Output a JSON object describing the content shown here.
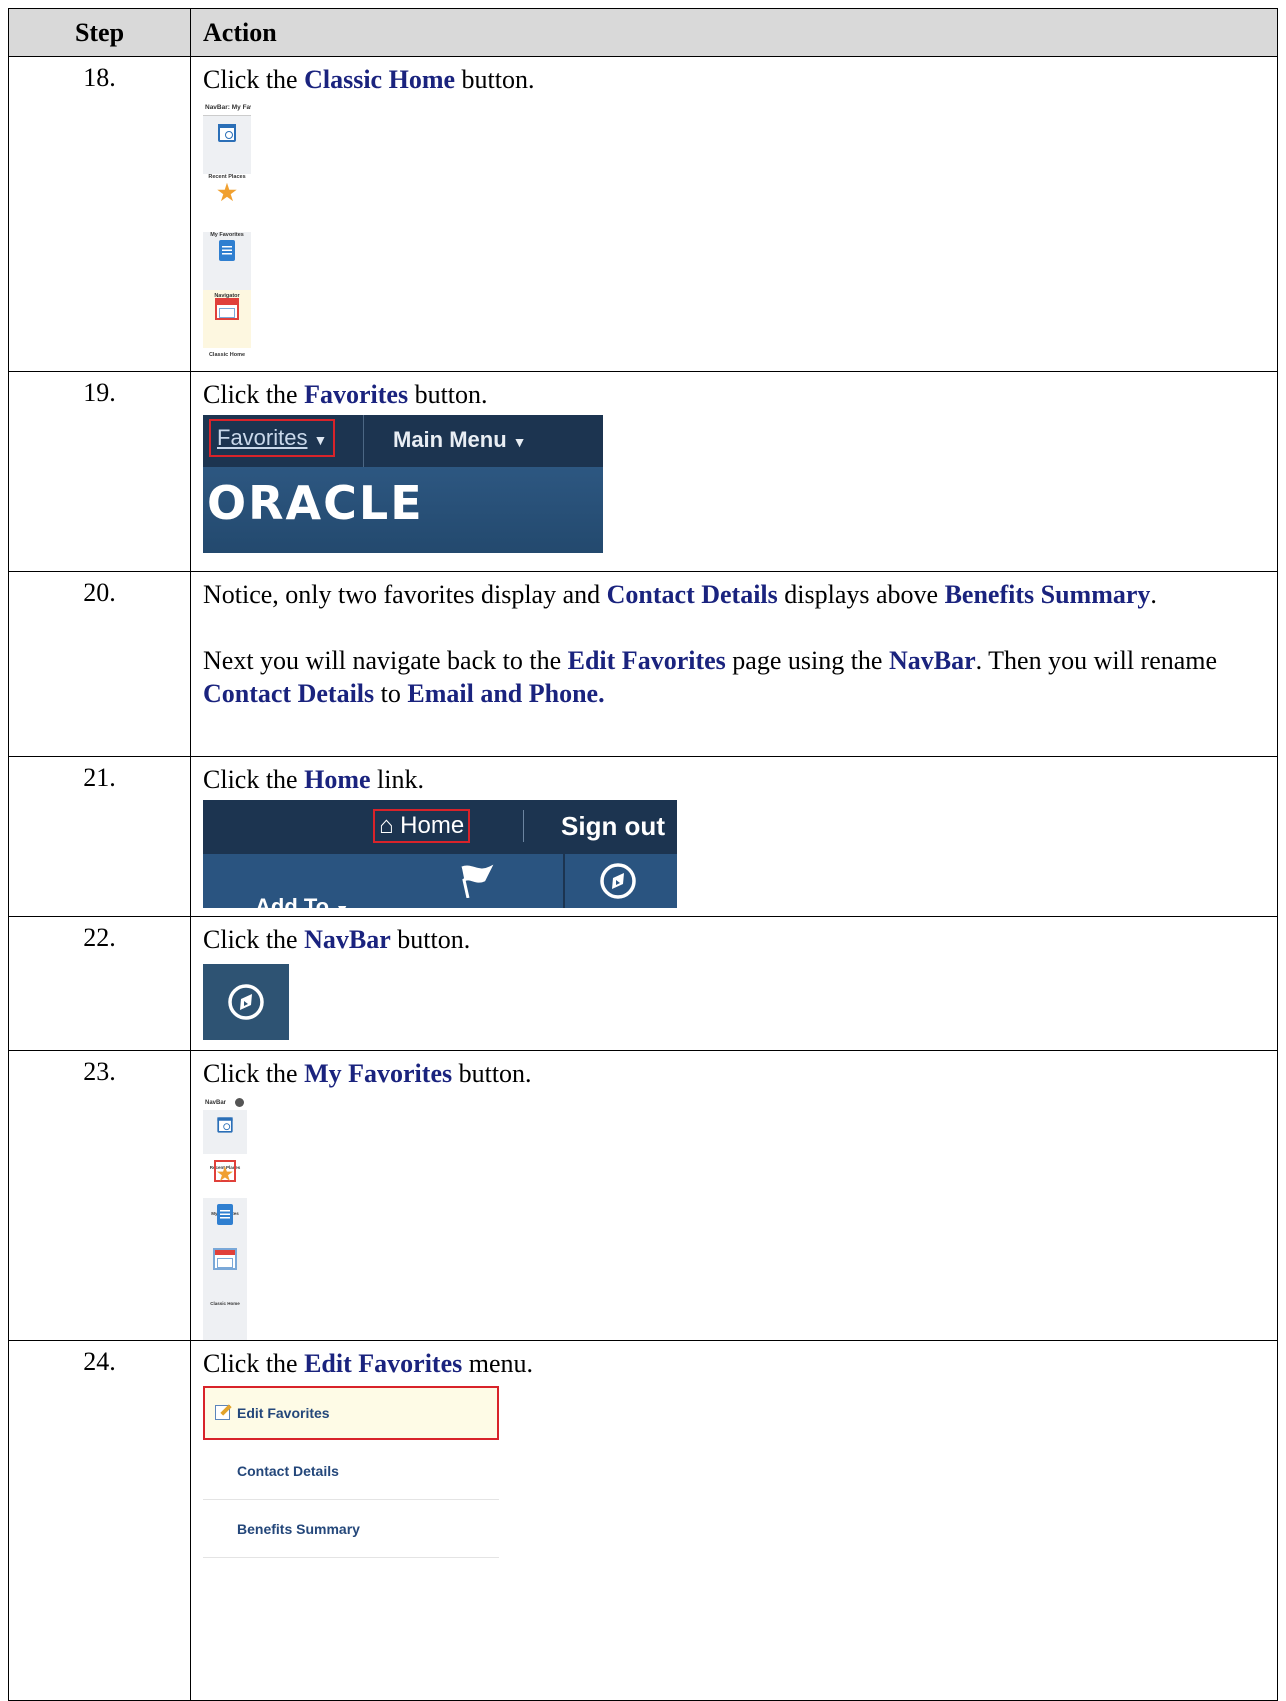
{
  "header": {
    "step": "Step",
    "action": "Action"
  },
  "rows": {
    "r18": {
      "step": "18.",
      "text_pre": "Click the ",
      "text_hl": "Classic Home",
      "text_post": " button.",
      "shot": {
        "header": "NavBar: My Fav",
        "items": [
          "Recent Places",
          "My Favorites",
          "Navigator",
          "Classic Home"
        ]
      }
    },
    "r19": {
      "step": "19.",
      "text_pre": "Click the ",
      "text_hl": "Favorites",
      "text_post": " button.",
      "shot": {
        "favorites": "Favorites",
        "main_menu": "Main Menu",
        "logo": "ORACLE",
        "arrow": "▼"
      }
    },
    "r20": {
      "step": "20.",
      "p1": {
        "a": "Notice, only two favorites display and ",
        "b": "Contact Details",
        "c": " displays above ",
        "d": "Benefits Summary",
        "e": "."
      },
      "p2": {
        "a": "Next you will navigate back to the ",
        "b": "Edit Favorites",
        "c": " page using the ",
        "d": "NavBar",
        "e": ". Then you will rename ",
        "f": "Contact Details",
        "g": " to  ",
        "h": "Email and Phone."
      }
    },
    "r21": {
      "step": "21.",
      "text_pre": "Click the ",
      "text_hl": "Home",
      "text_post": " link.",
      "shot": {
        "home": "Home",
        "sign_out": "Sign out",
        "add_to": "Add To",
        "home_glyph": "⌂",
        "arrow": "▼"
      }
    },
    "r22": {
      "step": "22.",
      "text_pre": "Click the ",
      "text_hl": "NavBar",
      "text_post": " button."
    },
    "r23": {
      "step": "23.",
      "text_pre": "Click the ",
      "text_hl": "My Favorites",
      "text_post": " button.",
      "shot": {
        "header": "NavBar",
        "items": [
          "Recent Places",
          "My Favorites",
          "Navigator",
          "Classic Home"
        ]
      }
    },
    "r24": {
      "step": "24.",
      "text_pre": "Click the ",
      "text_hl": "Edit Favorites",
      "text_post": " menu.",
      "menu": [
        "Edit Favorites",
        "Contact Details",
        "Benefits Summary"
      ]
    }
  },
  "colors": {
    "highlight_text": "#1a237e",
    "header_bg": "#d9d9d9",
    "oracle_navy": "#1c3450",
    "callout_red": "#d8232a"
  }
}
